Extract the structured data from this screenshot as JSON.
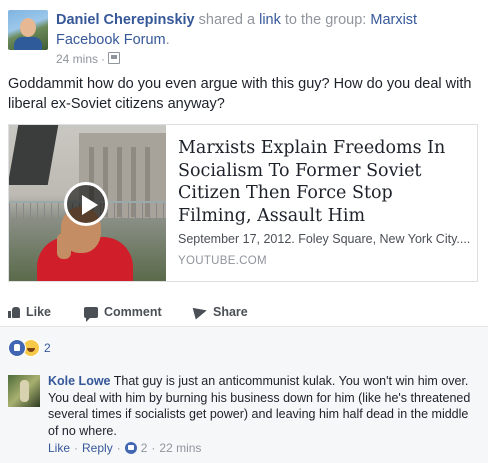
{
  "post": {
    "author": "Daniel Cherepinskiy",
    "shared_text": " shared a ",
    "link_word": "link",
    "to_group_text": " to the group: ",
    "group_name": "Marxist Facebook Forum",
    "period": ".",
    "time": "24 mins",
    "dot": "·",
    "privacy_icon": "group-icon",
    "text": "Goddammit how do you even argue with this guy? How do you deal with liberal ex-Soviet citizens anyway?"
  },
  "link_card": {
    "title": "Marxists Explain Freedoms In Socialism To Former Soviet Citizen Then Force Stop Filming, Assault Him",
    "description": "September 17, 2012. Foley Square, New York City....",
    "domain": "YOUTUBE.COM",
    "play_icon": "play-icon"
  },
  "actions": {
    "like": "Like",
    "comment": "Comment",
    "share": "Share"
  },
  "reactions": {
    "count": "2",
    "types": [
      "like",
      "haha"
    ]
  },
  "comment": {
    "author": "Kole Lowe",
    "text": " That guy is just an anticommunist kulak. You won't win him over. You deal with him by burning his business down for him (like he's threatened several times if socialists get power) and leaving him half dead in the middle of no where.",
    "like_label": "Like",
    "reply_label": "Reply",
    "sep": "·",
    "like_count": "2",
    "time": "22 mins"
  },
  "colors": {
    "link_blue": "#365899",
    "meta_gray": "#90949c",
    "comment_bg": "#f6f7f9",
    "like_blue": "#4267b2"
  }
}
